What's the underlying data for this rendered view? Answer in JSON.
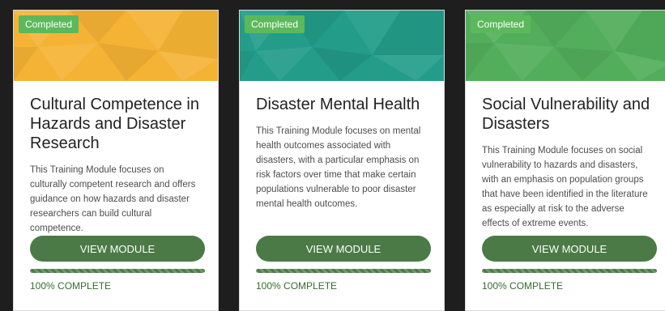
{
  "cards": [
    {
      "badge": "Completed",
      "title": "Cultural Competence in Hazards and Disaster Research",
      "description": "This Training Module focuses on culturally competent research and offers guidance on how hazards and disaster researchers can build cultural competence.",
      "button_label": "VIEW MODULE",
      "progress_percent": 100,
      "progress_text": "100% COMPLETE",
      "header_color": "#f5b335",
      "badge_color": "#5cb85c"
    },
    {
      "badge": "Completed",
      "title": "Disaster Mental Health",
      "description": "This Training Module focuses on mental health outcomes associated with disasters, with a particular emphasis on risk factors over time that make certain populations vulnerable to poor disaster mental health outcomes.",
      "button_label": "VIEW MODULE",
      "progress_percent": 100,
      "progress_text": "100% COMPLETE",
      "header_color": "#239d8a",
      "badge_color": "#5cb85c"
    },
    {
      "badge": "Completed",
      "title": "Social Vulnerability and Disasters",
      "description": "This Training Module focuses on social vulnerability to hazards and disasters, with an emphasis on population groups that have been identified in the literature as especially at risk to the adverse effects of extreme events.",
      "button_label": "VIEW MODULE",
      "progress_percent": 100,
      "progress_text": "100% COMPLETE",
      "header_color": "#53ae5c",
      "badge_color": "#5cb85c"
    }
  ],
  "colors": {
    "page_background": "#1e1e1f",
    "button": "#4b7a46",
    "progress_text": "#386b31"
  }
}
